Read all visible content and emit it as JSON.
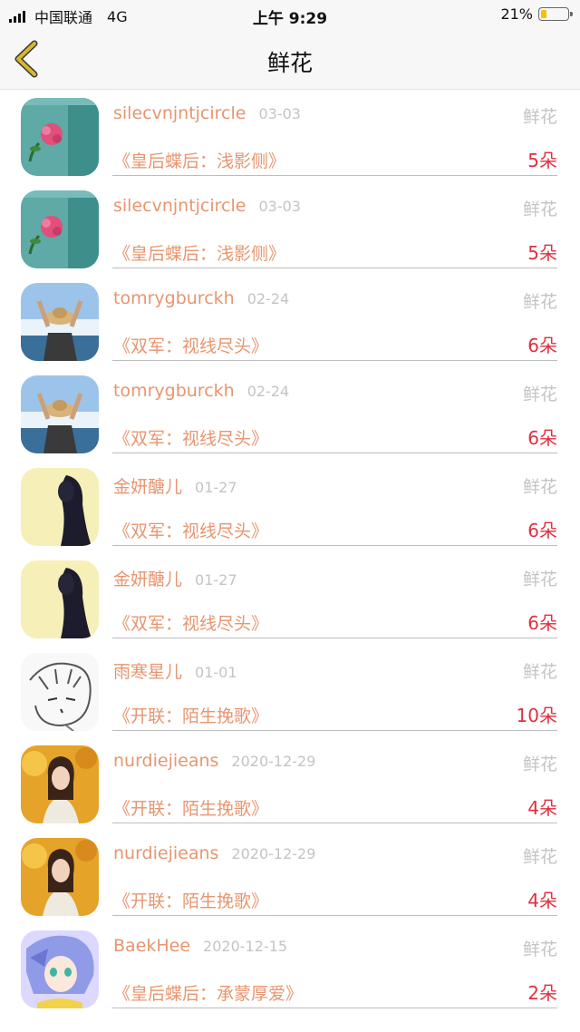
{
  "status_bar": {
    "carrier": "中国联通",
    "network": "4G",
    "time": "上午 9:29",
    "battery": "21%",
    "battery_level": 0.21
  },
  "header": {
    "title": "鲜花",
    "back_icon": "chevron-left-icon"
  },
  "colors": {
    "accent_name": "#e8956f",
    "count": "#e03040",
    "muted": "#c4c4c4",
    "back_icon": "#d7b72e"
  },
  "records": [
    {
      "user": "silecvnjntjcircle",
      "date": "03-03",
      "category": "鲜花",
      "work": "《皇后蝶后：浅影侧》",
      "count": "5朵",
      "avatar": "pink-flower"
    },
    {
      "user": "silecvnjntjcircle",
      "date": "03-03",
      "category": "鲜花",
      "work": "《皇后蝶后：浅影侧》",
      "count": "5朵",
      "avatar": "pink-flower"
    },
    {
      "user": "tomrygburckh",
      "date": "02-24",
      "category": "鲜花",
      "work": "《双军：视线尽头》",
      "count": "6朵",
      "avatar": "straw-hat"
    },
    {
      "user": "tomrygburckh",
      "date": "02-24",
      "category": "鲜花",
      "work": "《双军：视线尽头》",
      "count": "6朵",
      "avatar": "straw-hat"
    },
    {
      "user": "金妍醣儿",
      "date": "01-27",
      "category": "鲜花",
      "work": "《双军：视线尽头》",
      "count": "6朵",
      "avatar": "silhouette"
    },
    {
      "user": "金妍醣儿",
      "date": "01-27",
      "category": "鲜花",
      "work": "《双军：视线尽头》",
      "count": "6朵",
      "avatar": "silhouette"
    },
    {
      "user": "雨寒星儿",
      "date": "01-01",
      "category": "鲜花",
      "work": "《开联：陌生挽歌》",
      "count": "10朵",
      "avatar": "sketch"
    },
    {
      "user": "nurdiejieans",
      "date": "2020-12-29",
      "category": "鲜花",
      "work": "《开联：陌生挽歌》",
      "count": "4朵",
      "avatar": "autumn-girl"
    },
    {
      "user": "nurdiejieans",
      "date": "2020-12-29",
      "category": "鲜花",
      "work": "《开联：陌生挽歌》",
      "count": "4朵",
      "avatar": "autumn-girl"
    },
    {
      "user": "BaekHee",
      "date": "2020-12-15",
      "category": "鲜花",
      "work": "《皇后蝶后：承蒙厚爱》",
      "count": "2朵",
      "avatar": "anime"
    }
  ]
}
